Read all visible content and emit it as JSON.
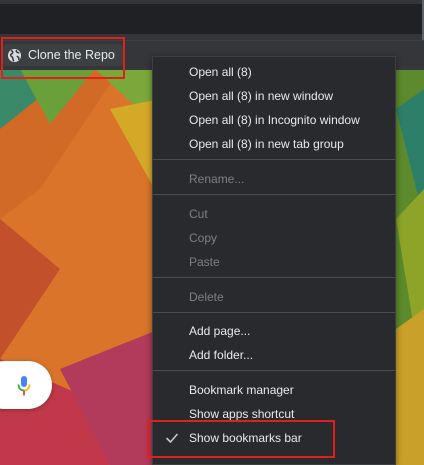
{
  "bookmarks_bar": {
    "items": [
      {
        "label": "Clone the Repo",
        "icon": "globe-icon"
      }
    ]
  },
  "context_menu": {
    "groups": [
      [
        {
          "label": "Open all (8)",
          "enabled": true
        },
        {
          "label": "Open all (8) in new window",
          "enabled": true
        },
        {
          "label": "Open all (8) in Incognito window",
          "enabled": true
        },
        {
          "label": "Open all (8) in new tab group",
          "enabled": true
        }
      ],
      [
        {
          "label": "Rename...",
          "enabled": false
        }
      ],
      [
        {
          "label": "Cut",
          "enabled": false
        },
        {
          "label": "Copy",
          "enabled": false
        },
        {
          "label": "Paste",
          "enabled": false
        }
      ],
      [
        {
          "label": "Delete",
          "enabled": false
        }
      ],
      [
        {
          "label": "Add page...",
          "enabled": true
        },
        {
          "label": "Add folder...",
          "enabled": true
        }
      ],
      [
        {
          "label": "Bookmark manager",
          "enabled": true
        },
        {
          "label": "Show apps shortcut",
          "enabled": true
        },
        {
          "label": "Show bookmarks bar",
          "enabled": true,
          "checked": true,
          "icon": "checkmark-icon"
        }
      ]
    ]
  },
  "voice_search": {
    "icon": "microphone-icon"
  },
  "colors": {
    "highlight": "#e0201b",
    "menu_background": "#292a2d",
    "toolbar": "#35363a"
  }
}
